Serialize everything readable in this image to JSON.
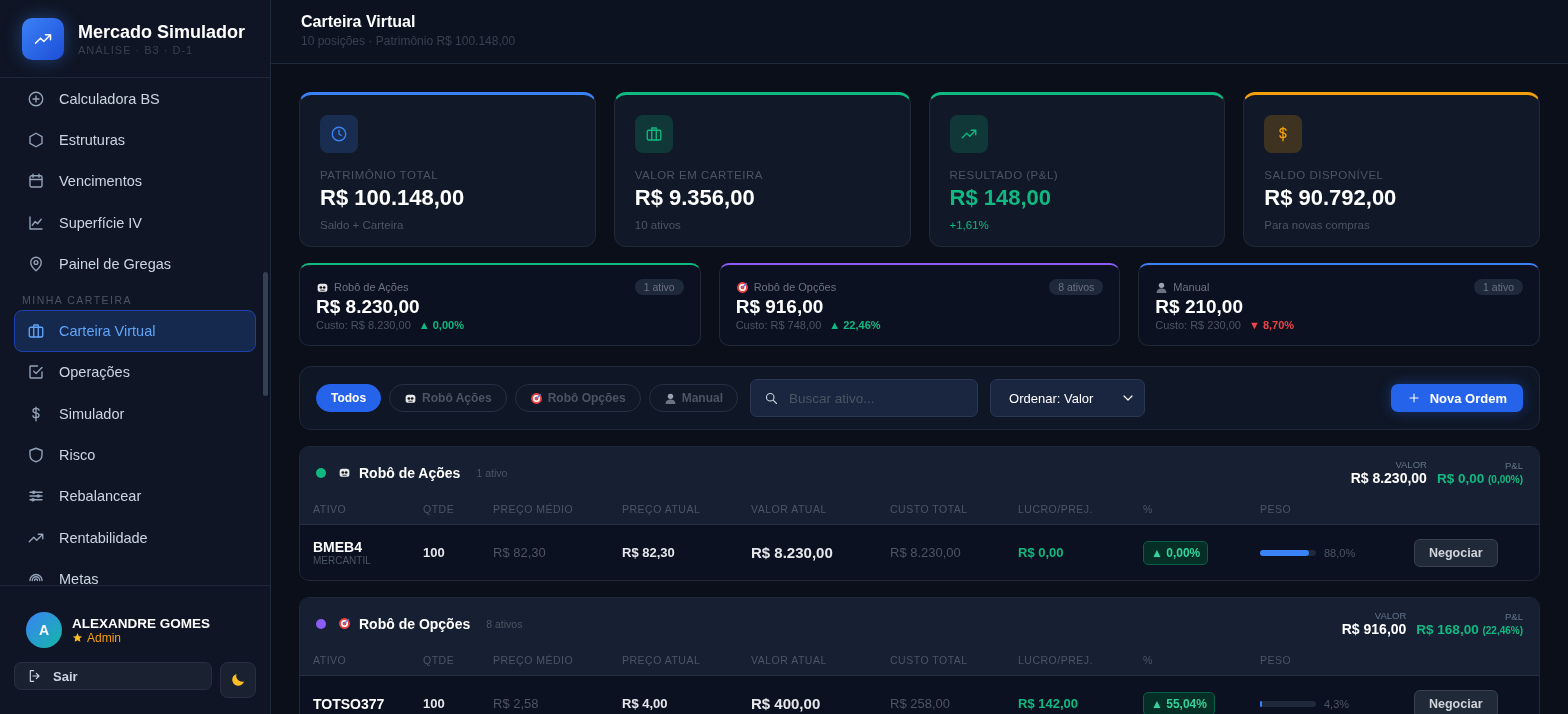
{
  "brand": {
    "title": "Mercado Simulador",
    "subtitle": "ANÁLISE · B3 · D-1"
  },
  "sidebar": {
    "items": [
      {
        "label": "Calculadora BS",
        "selected": false
      },
      {
        "label": "Estruturas",
        "selected": false
      },
      {
        "label": "Vencimentos",
        "selected": false
      },
      {
        "label": "Superfície IV",
        "selected": false
      },
      {
        "label": "Painel de Gregas",
        "selected": false
      }
    ],
    "section": {
      "title": "MINHA CARTEIRA",
      "items": [
        {
          "label": "Carteira Virtual",
          "selected": true
        },
        {
          "label": "Operações",
          "selected": false
        },
        {
          "label": "Simulador",
          "selected": false
        },
        {
          "label": "Risco",
          "selected": false
        },
        {
          "label": "Rebalancear",
          "selected": false
        },
        {
          "label": "Rentabilidade",
          "selected": false
        },
        {
          "label": "Metas",
          "selected": false
        }
      ]
    }
  },
  "user": {
    "initial": "A",
    "name": "ALEXANDRE GOMES",
    "role": "Admin"
  },
  "logout": {
    "label": "Sair"
  },
  "page": {
    "title": "Carteira Virtual",
    "subtitle": "10 posições · Patrimônio R$ 100.148,00"
  },
  "stat_cards": [
    {
      "label": "PATRIMÔNIO TOTAL",
      "value": "R$ 100.148,00",
      "note": "Saldo + Carteira",
      "color": "#3b82f6",
      "highlight": false
    },
    {
      "label": "VALOR EM CARTEIRA",
      "value": "R$ 9.356,00",
      "note": "10 ativos",
      "color": "#10b981",
      "highlight": false
    },
    {
      "label": "RESULTADO (P&L)",
      "value": "R$ 148,00",
      "note": "+1,61%",
      "color": "#10b981",
      "highlight": true
    },
    {
      "label": "SALDO DISPONÍVEL",
      "value": "R$ 90.792,00",
      "note": "Para novas compras",
      "color": "#f59e0b",
      "highlight": false
    }
  ],
  "strategy_cards": [
    {
      "name": "Robô de Ações",
      "badge": "1 ativo",
      "value": "R$ 8.230,00",
      "cost": "Custo: R$ 8.230,00",
      "change": "▲ 0,00%",
      "loss": false,
      "color": "#10b981"
    },
    {
      "name": "Robô de Opções",
      "badge": "8 ativos",
      "value": "R$ 916,00",
      "cost": "Custo: R$ 748,00",
      "change": "▲ 22,46%",
      "loss": false,
      "color": "#8b5cf6"
    },
    {
      "name": "Manual",
      "badge": "1 ativo",
      "value": "R$ 210,00",
      "cost": "Custo: R$ 230,00",
      "change": "▼ 8,70%",
      "loss": true,
      "color": "#3b82f6"
    }
  ],
  "filters": [
    {
      "label": "Todos",
      "selected": true
    },
    {
      "label": "Robô Ações",
      "selected": false
    },
    {
      "label": "Robô Opções",
      "selected": false
    },
    {
      "label": "Manual",
      "selected": false
    }
  ],
  "search": {
    "placeholder": "Buscar ativo..."
  },
  "sort": {
    "value": "Ordenar: Valor"
  },
  "new_order": {
    "label": "Nova Ordem"
  },
  "groups": [
    {
      "name": "Robô de Ações",
      "color": "#10b981",
      "count": "1 ativo",
      "value_label": "VALOR",
      "value": "R$ 8.230,00",
      "pl_label": "P&L",
      "pl": "R$ 0,00",
      "pl_pct": "(0,00%)",
      "columns": [
        "ATIVO",
        "QTDE",
        "PREÇO MÉDIO",
        "PREÇO ATUAL",
        "VALOR ATUAL",
        "CUSTO TOTAL",
        "LUCRO/PREJ.",
        "%",
        "PESO"
      ],
      "rows": [
        {
          "ticker": "BMEB4",
          "company": "MERCANTIL",
          "qty": "100",
          "avg_price": "R$ 82,30",
          "price": "R$ 82,30",
          "value": "R$ 8.230,00",
          "cost": "R$ 8.230,00",
          "pl": "R$ 0,00",
          "pct": "▲ 0,00%",
          "loss": false,
          "weight": "88,0%",
          "level": 0.88,
          "action": "Negociar"
        }
      ]
    },
    {
      "name": "Robô de Opções",
      "color": "#8b5cf6",
      "count": "8 ativos",
      "value_label": "VALOR",
      "value": "R$ 916,00",
      "pl_label": "P&L",
      "pl": "R$ 168,00",
      "pl_pct": "(22,46%)",
      "columns": [
        "ATIVO",
        "QTDE",
        "PREÇO MÉDIO",
        "PREÇO ATUAL",
        "VALOR ATUAL",
        "CUSTO TOTAL",
        "LUCRO/PREJ.",
        "%",
        "PESO"
      ],
      "rows": [
        {
          "ticker": "TOTSO377",
          "qty": "100",
          "avg_price": "R$ 2,58",
          "price": "R$ 4,00",
          "value": "R$ 400,00",
          "cost": "R$ 258,00",
          "pl": "R$ 142,00",
          "pct": "▲ 55,04%",
          "loss": false,
          "weight": "4,3%",
          "level": 0.043,
          "action": "Negociar"
        }
      ]
    }
  ]
}
